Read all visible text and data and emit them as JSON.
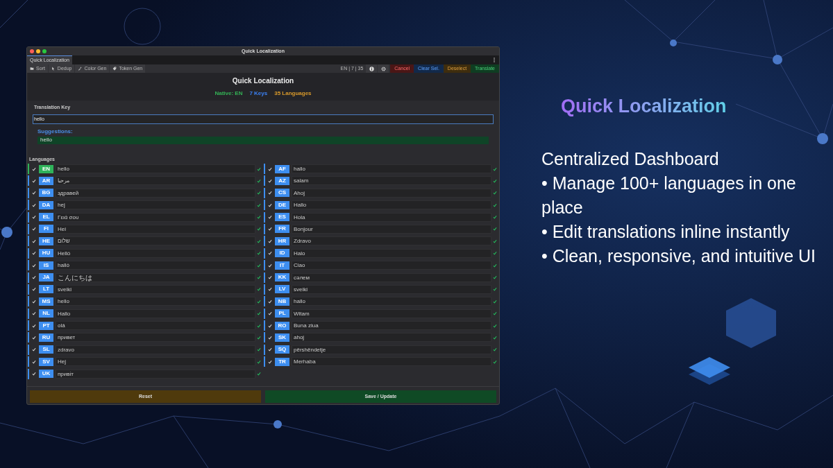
{
  "window": {
    "title": "Quick Localization"
  },
  "tabs": [
    {
      "label": "Quick Localization",
      "selected": true
    }
  ],
  "toolbar": {
    "tools": [
      {
        "label": "Sort",
        "kind": "folder"
      },
      {
        "label": "Dedup",
        "kind": "cursor"
      },
      {
        "label": "Color Gen",
        "kind": "dropper"
      },
      {
        "label": "Token Gen",
        "kind": "tag"
      }
    ],
    "summary": "EN | 7 | 35",
    "actions": [
      {
        "label": "Cancel",
        "kind": "danger"
      },
      {
        "label": "Clear Sel.",
        "kind": "info"
      },
      {
        "label": "Deselect",
        "kind": "warning"
      },
      {
        "label": "Translate",
        "kind": "success"
      }
    ]
  },
  "header": {
    "title": "Quick Localization",
    "stats": [
      {
        "text": "Native: EN",
        "color": "#34b356"
      },
      {
        "text": "7 Keys",
        "color": "#3b82f6"
      },
      {
        "text": "35 Languages",
        "color": "#d99a2b"
      }
    ]
  },
  "translation_key": {
    "label": "Translation Key",
    "value": "hello",
    "suggestions_label": "Suggestions:",
    "suggestions": [
      "hello"
    ]
  },
  "languages_label": "Languages",
  "language_columns": [
    [
      {
        "code": "EN",
        "text": "hello",
        "native": true,
        "checked": true,
        "valid": true
      },
      {
        "code": "AR",
        "text": "مرحبا",
        "native": false,
        "checked": true,
        "valid": true
      },
      {
        "code": "BG",
        "text": "здравей",
        "native": false,
        "checked": true,
        "valid": true
      },
      {
        "code": "DA",
        "text": "hej",
        "native": false,
        "checked": true,
        "valid": true
      },
      {
        "code": "EL",
        "text": "Γειά σου",
        "native": false,
        "checked": true,
        "valid": true
      },
      {
        "code": "FI",
        "text": "Hei",
        "native": false,
        "checked": true,
        "valid": true
      },
      {
        "code": "HE",
        "text": "שלום",
        "native": false,
        "checked": true,
        "valid": true
      },
      {
        "code": "HU",
        "text": "Helló",
        "native": false,
        "checked": true,
        "valid": true
      },
      {
        "code": "IS",
        "text": "halló",
        "native": false,
        "checked": true,
        "valid": true
      },
      {
        "code": "JA",
        "text": "こんにちは",
        "native": false,
        "checked": true,
        "valid": true
      },
      {
        "code": "LT",
        "text": "sveiki",
        "native": false,
        "checked": true,
        "valid": true
      },
      {
        "code": "MS",
        "text": "hello",
        "native": false,
        "checked": true,
        "valid": true
      },
      {
        "code": "NL",
        "text": "Hallo",
        "native": false,
        "checked": true,
        "valid": true
      },
      {
        "code": "PT",
        "text": "olá",
        "native": false,
        "checked": true,
        "valid": true
      },
      {
        "code": "RU",
        "text": "привет",
        "native": false,
        "checked": true,
        "valid": true
      },
      {
        "code": "SL",
        "text": "zdravo",
        "native": false,
        "checked": true,
        "valid": true
      },
      {
        "code": "SV",
        "text": "Hej",
        "native": false,
        "checked": true,
        "valid": true
      },
      {
        "code": "UK",
        "text": "привіт",
        "native": false,
        "checked": true,
        "valid": true
      }
    ],
    [
      {
        "code": "AF",
        "text": "hallo",
        "native": false,
        "checked": true,
        "valid": true
      },
      {
        "code": "AZ",
        "text": "salam",
        "native": false,
        "checked": true,
        "valid": true
      },
      {
        "code": "CS",
        "text": "Ahoj",
        "native": false,
        "checked": true,
        "valid": true
      },
      {
        "code": "DE",
        "text": "Hallo",
        "native": false,
        "checked": true,
        "valid": true
      },
      {
        "code": "ES",
        "text": "Hola",
        "native": false,
        "checked": true,
        "valid": true
      },
      {
        "code": "FR",
        "text": "Bonjour",
        "native": false,
        "checked": true,
        "valid": true
      },
      {
        "code": "HR",
        "text": "Zdravo",
        "native": false,
        "checked": true,
        "valid": true
      },
      {
        "code": "ID",
        "text": "Halo",
        "native": false,
        "checked": true,
        "valid": true
      },
      {
        "code": "IT",
        "text": "Ciao",
        "native": false,
        "checked": true,
        "valid": true
      },
      {
        "code": "KK",
        "text": "сәлем",
        "native": false,
        "checked": true,
        "valid": true
      },
      {
        "code": "LV",
        "text": "sveiki",
        "native": false,
        "checked": true,
        "valid": true
      },
      {
        "code": "NB",
        "text": "hallo",
        "native": false,
        "checked": true,
        "valid": true
      },
      {
        "code": "PL",
        "text": "Witam",
        "native": false,
        "checked": true,
        "valid": true
      },
      {
        "code": "RO",
        "text": "Buna ziua",
        "native": false,
        "checked": true,
        "valid": true
      },
      {
        "code": "SK",
        "text": "ahoj",
        "native": false,
        "checked": true,
        "valid": true
      },
      {
        "code": "SQ",
        "text": "përshëndetje",
        "native": false,
        "checked": true,
        "valid": true
      },
      {
        "code": "TR",
        "text": "Merhaba",
        "native": false,
        "checked": true,
        "valid": true
      }
    ]
  ],
  "footer_buttons": [
    {
      "label": "Reset",
      "kind": "warning"
    },
    {
      "label": "Save / Update",
      "kind": "success"
    }
  ],
  "promo": {
    "title": "Quick Localization",
    "lines": [
      "Centralized Dashboard",
      "• Manage 100+ languages in one place",
      "• Edit translations inline instantly",
      "• Clean, responsive, and intuitive UI"
    ]
  }
}
